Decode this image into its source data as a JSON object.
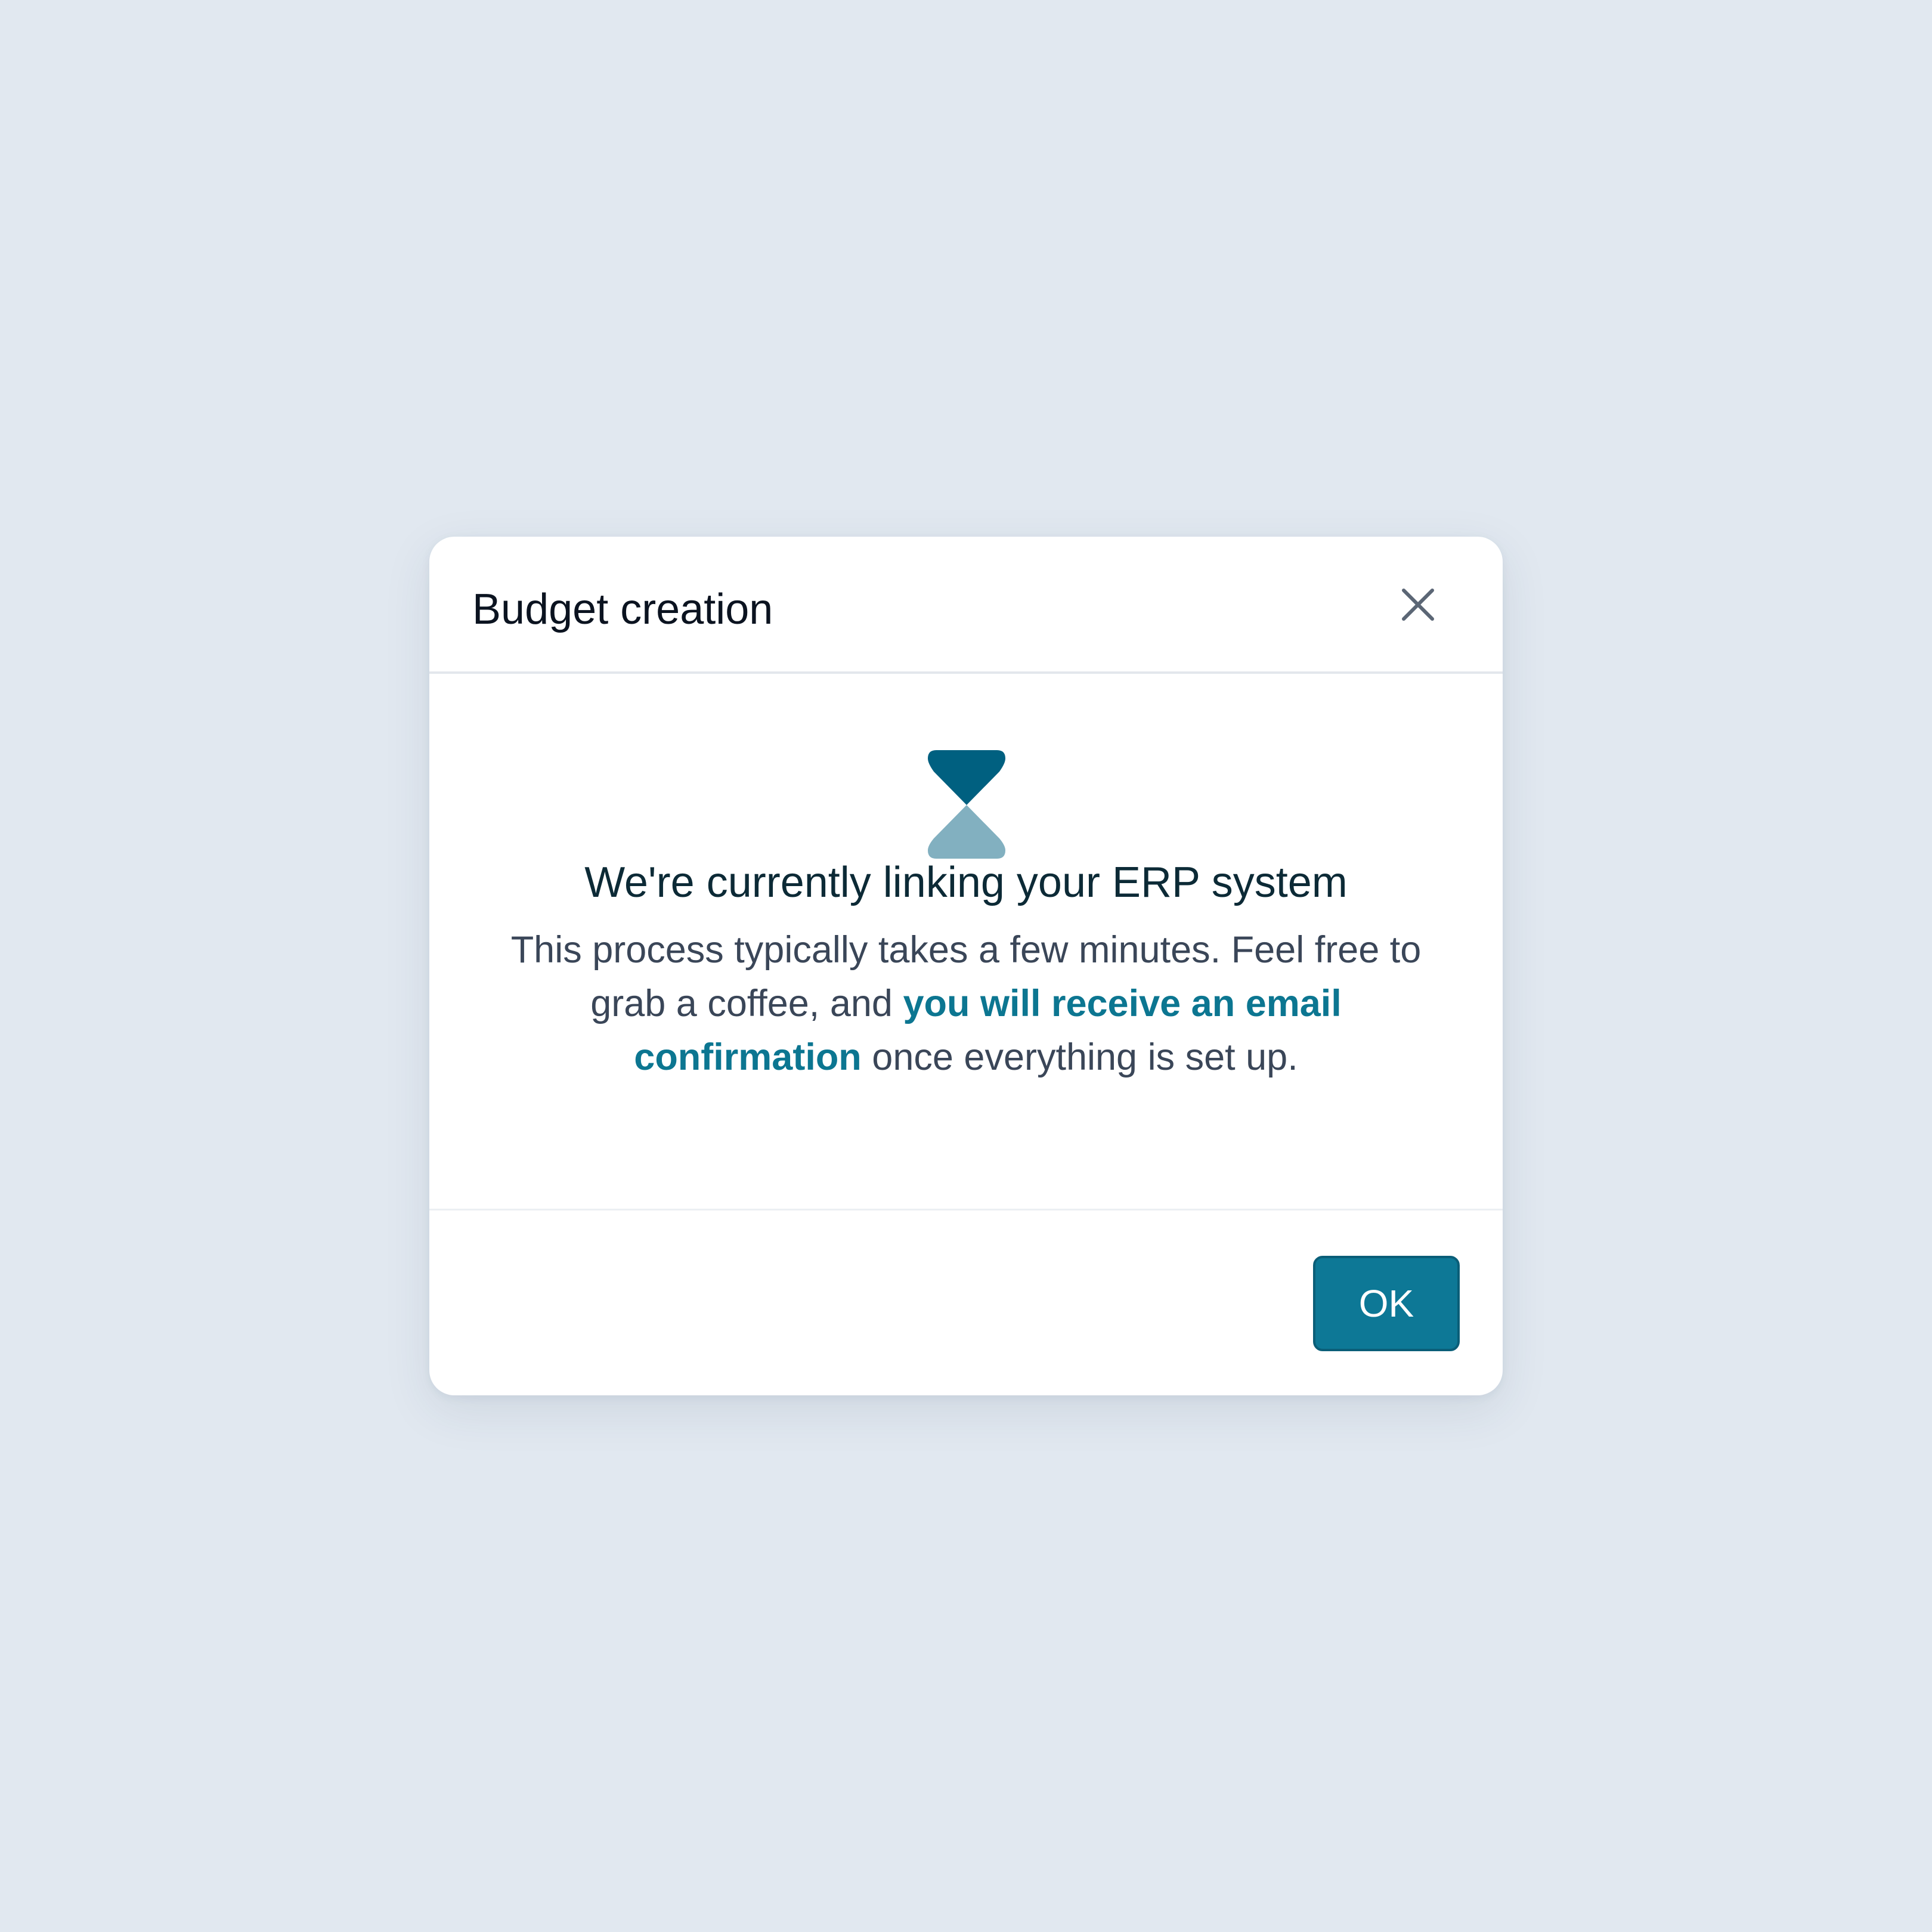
{
  "modal": {
    "title": "Budget creation",
    "close_icon": "close-icon",
    "status_icon": "hourglass-icon",
    "headline": "We're currently linking your ERP system",
    "description": {
      "before": "This process typically takes a few minutes. Feel free to grab a coffee, and ",
      "highlight": "you will receive an email confirmation",
      "after": " once everything is set up."
    },
    "ok_label": "OK"
  },
  "colors": {
    "background": "#e1e8f0",
    "accent": "#0d7896",
    "hourglass_top": "#006080",
    "hourglass_bottom": "#82b0c0",
    "highlight_text": "#0c7691"
  }
}
